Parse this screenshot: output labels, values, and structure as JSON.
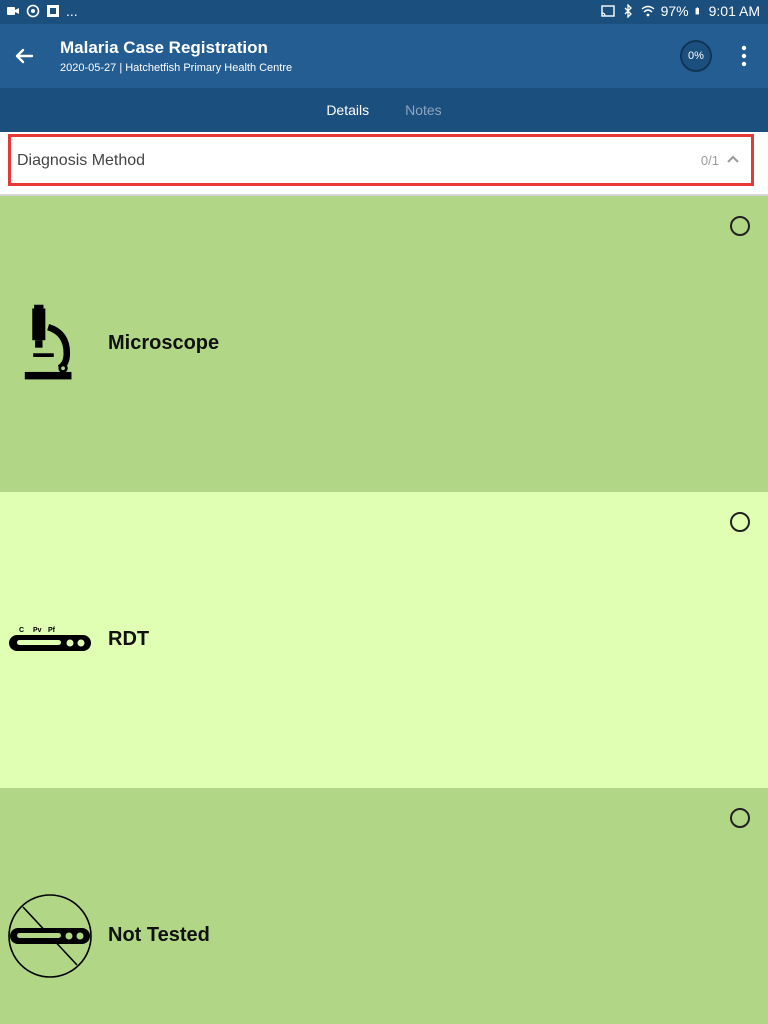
{
  "status_bar": {
    "left_ellipsis": "...",
    "battery": "97%",
    "time": "9:01 AM"
  },
  "header": {
    "title": "Malaria Case Registration",
    "subtitle": "2020-05-27 | Hatchetfish Primary Health Centre",
    "progress": "0%"
  },
  "tabs": [
    {
      "label": "Details",
      "active": true
    },
    {
      "label": "Notes",
      "active": false
    }
  ],
  "section": {
    "title": "Diagnosis Method",
    "count": "0/1"
  },
  "options": [
    {
      "label": "Microscope",
      "icon": "microscope-icon",
      "color": "#b0d686"
    },
    {
      "label": "RDT",
      "icon": "rdt-cassette-icon",
      "icon_text": [
        "C",
        "Pv",
        "Pf"
      ],
      "color": "#e0ffb3"
    },
    {
      "label": "Not Tested",
      "icon": "not-tested-icon",
      "color": "#b0d686"
    }
  ],
  "colors": {
    "status_bar": "#1b4f7e",
    "app_bar": "#245d92",
    "tab_bar": "#1b4f7e",
    "highlight": "#e53935"
  }
}
